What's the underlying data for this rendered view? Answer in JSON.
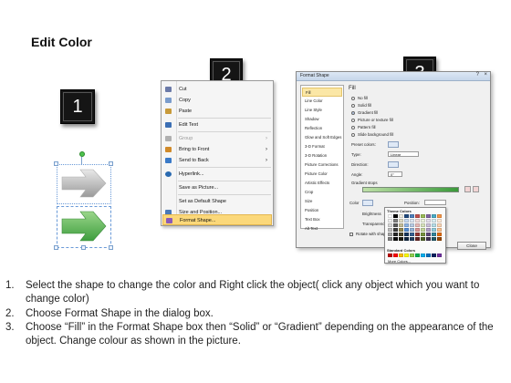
{
  "page": {
    "title": "Edit Color"
  },
  "steps": [
    {
      "number": "1"
    },
    {
      "number": "2"
    },
    {
      "number": "3"
    }
  ],
  "context_menu": {
    "items": [
      {
        "label": "Cut",
        "icon": "scissors-icon",
        "icon_color": "#6b7aa8"
      },
      {
        "label": "Copy",
        "icon": "copy-icon",
        "icon_color": "#7a9ccc"
      },
      {
        "label": "Paste",
        "icon": "paste-icon",
        "icon_color": "#c89a3a"
      },
      {
        "label": "Edit Text",
        "icon": "edit-text-icon",
        "icon_color": "#3c6fb4"
      },
      {
        "label": "Group",
        "icon": "group-icon",
        "icon_color": "#b0b0b0",
        "disabled": true,
        "submenu": true
      },
      {
        "label": "Bring to Front",
        "icon": "bring-front-icon",
        "icon_color": "#d08a2a",
        "submenu": true
      },
      {
        "label": "Send to Back",
        "icon": "send-back-icon",
        "icon_color": "#3a7ac8",
        "submenu": true
      },
      {
        "label": "Hyperlink...",
        "icon": "hyperlink-icon",
        "icon_color": "#2a6ab0"
      },
      {
        "label": "Save as Picture...",
        "icon": "none",
        "icon_color": "#f5f5f5"
      },
      {
        "label": "Set as Default Shape",
        "icon": "none",
        "icon_color": "#f5f5f5"
      },
      {
        "label": "Size and Position...",
        "icon": "size-position-icon",
        "icon_color": "#4a7ab8"
      },
      {
        "label": "Format Shape...",
        "icon": "format-shape-icon",
        "icon_color": "#8a5ab8",
        "active": true
      }
    ]
  },
  "dialog": {
    "title": "Format Shape",
    "close_glyph": "×",
    "help_glyph": "?",
    "left_items": [
      "Fill",
      "Line Color",
      "Line Style",
      "Shadow",
      "Reflection",
      "Glow and Soft Edges",
      "3-D Format",
      "3-D Rotation",
      "Picture Corrections",
      "Picture Color",
      "Artistic Effects",
      "Crop",
      "Size",
      "Position",
      "Text Box",
      "Alt Text"
    ],
    "section_title": "Fill",
    "fill_options": [
      {
        "label": "No fill",
        "checked": false
      },
      {
        "label": "Solid fill",
        "checked": false
      },
      {
        "label": "Gradient fill",
        "checked": true
      },
      {
        "label": "Picture or texture fill",
        "checked": false
      },
      {
        "label": "Pattern fill",
        "checked": false
      },
      {
        "label": "Slide background fill",
        "checked": false
      }
    ],
    "preset_colors_label": "Preset colors:",
    "type_label": "Type:",
    "type_value": "Linear",
    "direction_label": "Direction:",
    "angle_label": "Angle:",
    "angle_value": "0°",
    "gradient_stops_label": "Gradient stops",
    "color_label": "Color",
    "position_label": "Position:",
    "brightness_label": "Brightness",
    "transparency_label": "Transparency",
    "rotate_label": "Rotate with shape",
    "close_label": "Close",
    "palette": {
      "theme_label": "Theme Colors",
      "standard_label": "Standard Colors",
      "more_label": "More Colors...",
      "theme_colors": [
        "#ffffff",
        "#000000",
        "#eeece1",
        "#1f497d",
        "#4f81bd",
        "#c0504d",
        "#9bbb59",
        "#8064a2",
        "#4bacc6",
        "#f79646",
        "#f2f2f2",
        "#7f7f7f",
        "#ddd9c3",
        "#c6d9f0",
        "#dbe5f1",
        "#f2dcdb",
        "#ebf1dd",
        "#e5e0ec",
        "#dbeef3",
        "#fdeada",
        "#d8d8d8",
        "#595959",
        "#c4bd97",
        "#8db3e2",
        "#b8cce4",
        "#e5b9b7",
        "#d7e3bc",
        "#ccc1d9",
        "#b7dde8",
        "#fbd5b5",
        "#bfbfbf",
        "#3f3f3f",
        "#938953",
        "#548dd4",
        "#95b3d7",
        "#d99694",
        "#c3d69b",
        "#b2a2c7",
        "#92cddc",
        "#fac08f",
        "#a5a5a5",
        "#262626",
        "#494429",
        "#17365d",
        "#366092",
        "#953734",
        "#76923c",
        "#5f497a",
        "#31859b",
        "#e36c09",
        "#7f7f7f",
        "#0c0c0c",
        "#1d1b10",
        "#0f243e",
        "#244061",
        "#632423",
        "#4f6128",
        "#3f3151",
        "#205867",
        "#974806"
      ],
      "standard_colors": [
        "#c00000",
        "#ff0000",
        "#ffc000",
        "#ffff00",
        "#92d050",
        "#00b050",
        "#00b0f0",
        "#0070c0",
        "#002060",
        "#7030a0"
      ]
    }
  },
  "shapes": {
    "top_arrow_color": "#a8a8a8",
    "bottom_arrow_color": "#5cb85c"
  },
  "instructions": [
    {
      "num": "1.",
      "text": "Select the shape to change the color and Right click the object( click any object which you want to change color)"
    },
    {
      "num": "2.",
      "text": "Choose Format Shape in the dialog box."
    },
    {
      "num": "3.",
      "text": "Choose “Fill” in the Format Shape box then “Solid” or “Gradient” depending on the appearance of the object. Change colour as shown in the picture."
    }
  ]
}
